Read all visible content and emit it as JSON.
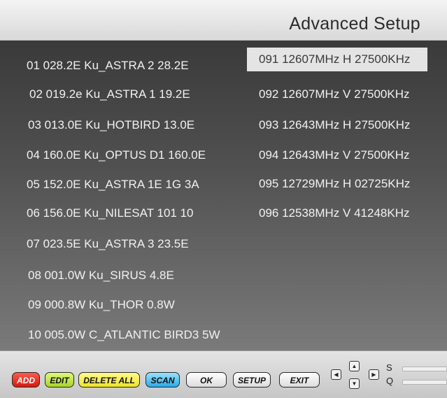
{
  "header": {
    "title": "Advanced Setup"
  },
  "satellites": [
    "01 028.2E Ku_ASTRA 2 28.2E",
    "02 019.2e Ku_ASTRA 1 19.2E",
    "03 013.0E Ku_HOTBIRD 13.0E",
    "04 160.0E Ku_OPTUS D1 160.0E",
    "05 152.0E Ku_ASTRA 1E 1G 3A",
    "06 156.0E Ku_NILESAT 101 10",
    "07 023.5E Ku_ASTRA 3 23.5E",
    "08 001.0W Ku_SIRUS 4.8E",
    "09 000.8W Ku_THOR 0.8W",
    "10 005.0W C_ATLANTIC BIRD3 5W"
  ],
  "transponders": [
    "091 12607MHz H 27500KHz",
    "092 12607MHz V 27500KHz",
    "093 12643MHz H 27500KHz",
    "094 12643MHz V 27500KHz",
    "095 12729MHz H 02725KHz",
    "096 12538MHz V 41248KHz"
  ],
  "footer": {
    "add": "ADD",
    "edit": "EDIT",
    "delete_all": "DELETE ALL",
    "scan": "SCAN",
    "ok": "OK",
    "setup": "SETUP",
    "exit": "EXIT",
    "arrow_left": "◀",
    "arrow_up": "▲",
    "arrow_down": "▼",
    "arrow_right": "▶",
    "signal_label": "S",
    "quality_label": "Q"
  },
  "colors": {
    "add": "#e8261f",
    "edit": "#c6e63c",
    "delete_all": "#f6ef3a",
    "scan": "#30b4ee"
  }
}
